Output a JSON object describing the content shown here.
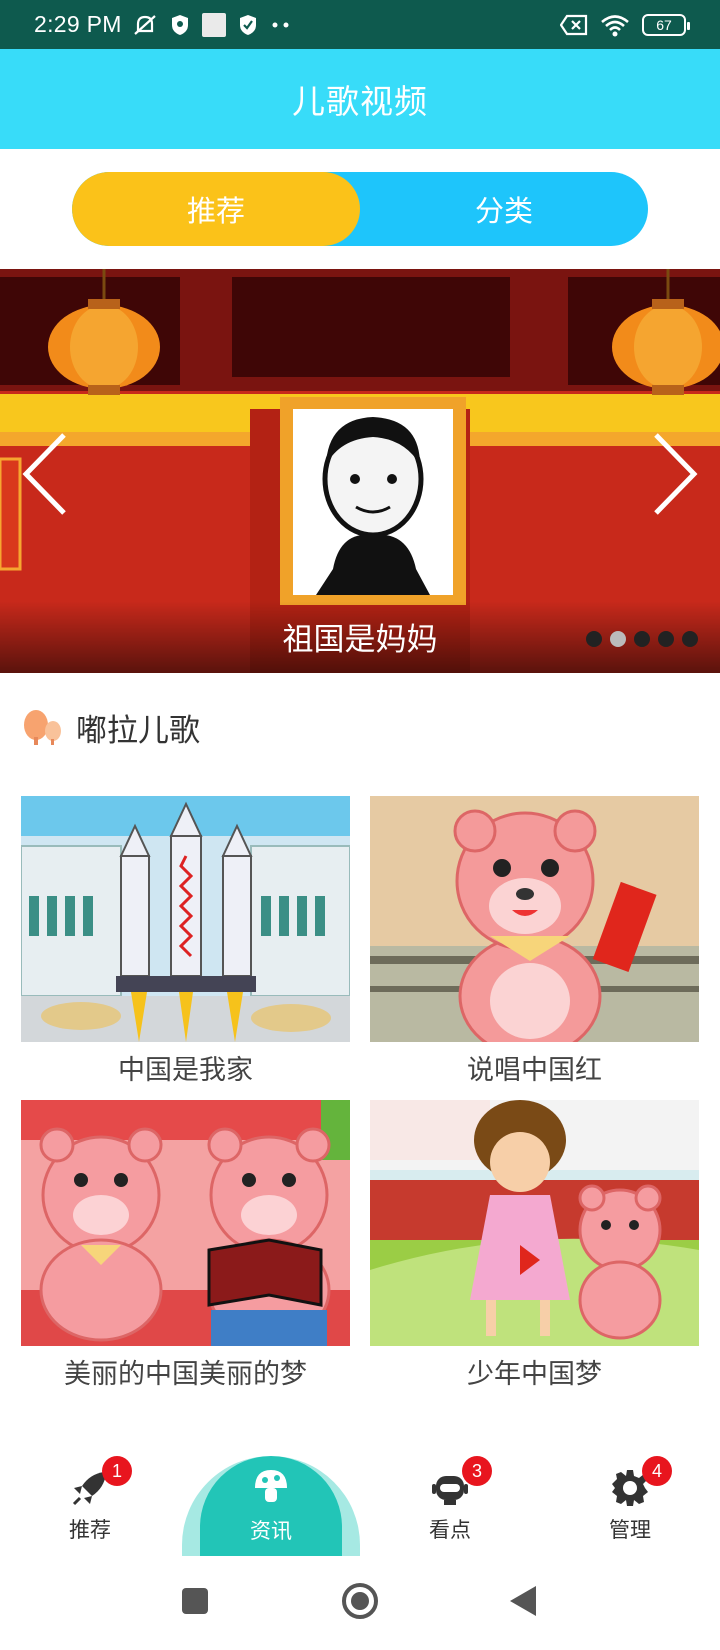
{
  "status_bar": {
    "time": "2:29 PM",
    "battery": "67"
  },
  "header": {
    "title": "儿歌视频"
  },
  "tabs": [
    {
      "label": "推荐",
      "active": true
    },
    {
      "label": "分类",
      "active": false
    }
  ],
  "banner": {
    "caption": "祖国是妈妈",
    "page_count": 5,
    "active_page": 2
  },
  "section": {
    "title": "嘟拉儿歌"
  },
  "videos": [
    {
      "title": "中国是我家"
    },
    {
      "title": "说唱中国红"
    },
    {
      "title": "美丽的中国美丽的梦"
    },
    {
      "title": "少年中国梦"
    }
  ],
  "bottom_nav": [
    {
      "label": "推荐",
      "badge": "1",
      "icon": "rocket-icon"
    },
    {
      "label": "资讯",
      "badge": "",
      "icon": "mushroom-icon",
      "active": true
    },
    {
      "label": "看点",
      "badge": "3",
      "icon": "robot-icon"
    },
    {
      "label": "管理",
      "badge": "4",
      "icon": "gear-icon"
    }
  ],
  "colors": {
    "header": "#38dcf9",
    "tab_active": "#fbc219",
    "tab_inactive": "#1ec5fb",
    "nav_active": "#22c5b7",
    "badge": "#e8151e",
    "status_bar": "#0e5a4e"
  }
}
